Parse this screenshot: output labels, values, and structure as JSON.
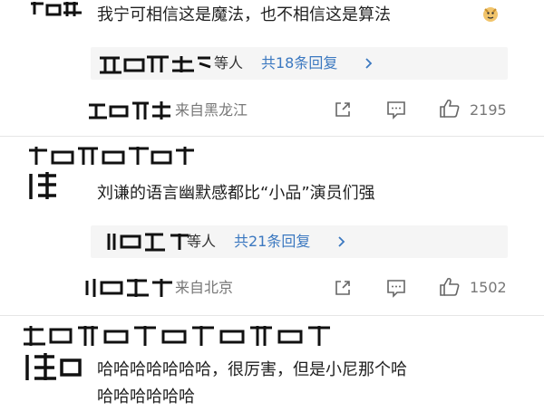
{
  "comments": [
    {
      "text": "我宁可相信这是魔法，也不相信这是算法",
      "emoji_icon": "doge-emoji-icon",
      "reply_suffix": "等人",
      "reply_count": "共18条回复",
      "location": "来自黑龙江",
      "likes": "2195"
    },
    {
      "text": "刘谦的语言幽默感都比“小品”演员们强",
      "reply_suffix": "等人",
      "reply_count": "共21条回复",
      "location": "来自北京",
      "likes": "1502"
    },
    {
      "text_line1": "哈哈哈哈哈哈哈，很厉害，但是小尼那个哈",
      "text_line2": "哈哈哈哈哈哈"
    }
  ],
  "colors": {
    "link_blue": "#3b78c0",
    "meta_gray": "#777777",
    "reply_bg": "#f5f5f5"
  },
  "icons": {
    "share": "share-icon",
    "comment": "comment-icon",
    "like": "thumbs-up-icon",
    "chevron": "chevron-right-icon"
  }
}
